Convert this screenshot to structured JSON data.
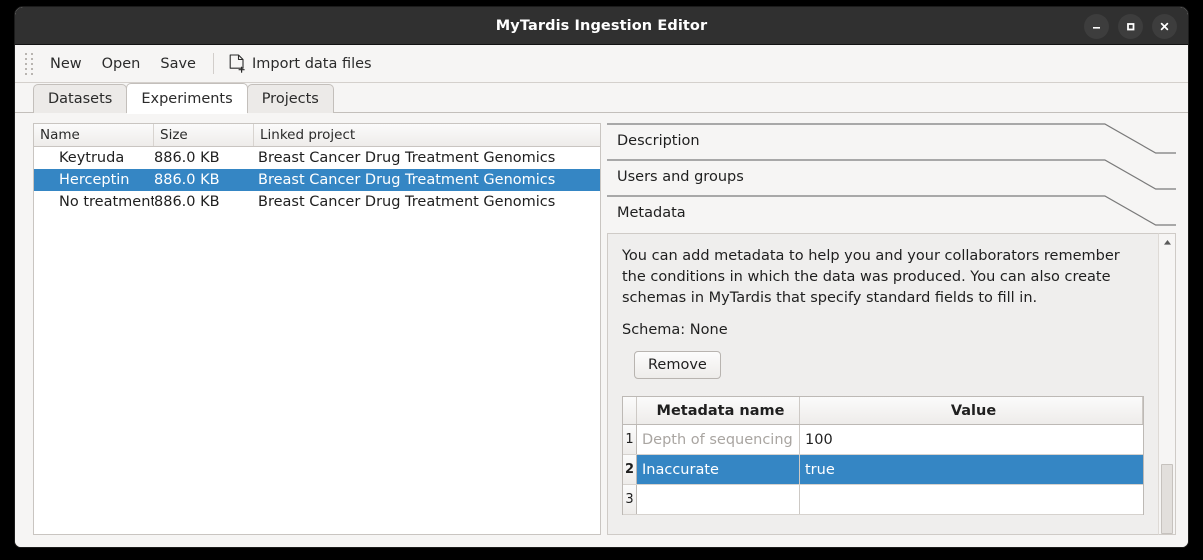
{
  "window": {
    "title": "MyTardis Ingestion Editor",
    "controls": [
      {
        "name": "minimize-button",
        "glyph": "–"
      },
      {
        "name": "maximize-button",
        "glyph": "□"
      },
      {
        "name": "close-button",
        "glyph": "✕"
      }
    ]
  },
  "toolbar": {
    "new_label": "New",
    "open_label": "Open",
    "save_label": "Save",
    "import_label": "Import data files",
    "import_icon": "document-add-icon",
    "grip_icon": "drag-handle-icon"
  },
  "tabs": [
    {
      "label": "Datasets",
      "active": false
    },
    {
      "label": "Experiments",
      "active": true
    },
    {
      "label": "Projects",
      "active": false
    }
  ],
  "datasets_table": {
    "columns": [
      "Name",
      "Size",
      "Linked project"
    ],
    "rows": [
      {
        "name": "Keytruda",
        "size": "886.0 KB",
        "project": "Breast Cancer Drug Treatment Genomics",
        "selected": false
      },
      {
        "name": "Herceptin",
        "size": "886.0 KB",
        "project": "Breast Cancer Drug Treatment Genomics",
        "selected": true
      },
      {
        "name": "No treatment",
        "size": "886.0 KB",
        "project": "Breast Cancer Drug Treatment Genomics",
        "selected": false
      }
    ]
  },
  "expanders": [
    {
      "label": "Description"
    },
    {
      "label": "Users and groups"
    },
    {
      "label": "Metadata"
    }
  ],
  "metadata_panel": {
    "description": "You can add metadata to help you and your collaborators remember the conditions in which the data was produced. You can also create schemas in MyTardis that specify standard fields to fill in.",
    "schema_line": "Schema: None",
    "remove_label": "Remove",
    "table": {
      "columns": [
        "Metadata name",
        "Value"
      ],
      "rows": [
        {
          "index": "1",
          "key": "Depth of sequencing",
          "value": "100",
          "key_is_placeholder": true,
          "selected": false
        },
        {
          "index": "2",
          "key": "Inaccurate",
          "value": "true",
          "key_is_placeholder": false,
          "selected": true
        },
        {
          "index": "3",
          "key": "",
          "value": "",
          "key_is_placeholder": false,
          "selected": false
        }
      ]
    },
    "scrollbar": {
      "up_icon": "scroll-up-arrow-icon",
      "down_icon": "scroll-down-arrow-icon",
      "thumb_name": "scrollbar-thumb"
    }
  },
  "colors": {
    "selection_blue": "#3586c4",
    "titlebar": "#303030",
    "window_bg": "#f6f5f4",
    "placeholder_grey": "#a9a5a1"
  }
}
